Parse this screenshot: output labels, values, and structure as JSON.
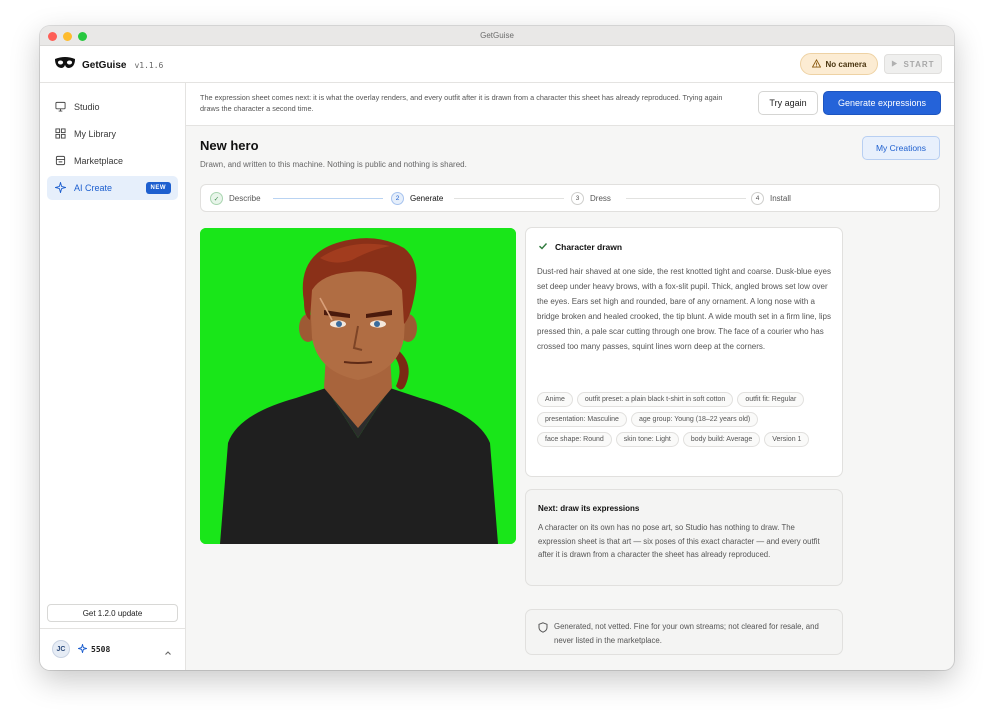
{
  "window": {
    "title": "GetGuise"
  },
  "app": {
    "name": "GetGuise",
    "version": "v1.1.6"
  },
  "topbar": {
    "camera_status": "No camera",
    "start_label": "START"
  },
  "sidebar": {
    "items": [
      {
        "label": "Studio",
        "icon": "monitor-icon"
      },
      {
        "label": "My Library",
        "icon": "grid-icon"
      },
      {
        "label": "Marketplace",
        "icon": "store-icon"
      },
      {
        "label": "AI Create",
        "icon": "sparkle-icon",
        "badge": "NEW",
        "active": true
      }
    ],
    "update_label": "Get 1.2.0 update",
    "user": {
      "initials": "JC",
      "credits": "5508"
    }
  },
  "notice": {
    "text": "The expression sheet comes next: it is what the overlay renders, and every outfit after it is drawn from a character this sheet has already reproduced. Trying again draws the character a second time.",
    "retry_label": "Try again",
    "generate_label": "Generate expressions"
  },
  "page": {
    "title": "New hero",
    "subtitle": "Drawn, and written to this machine. Nothing is public and nothing is shared.",
    "creations_label": "My Creations"
  },
  "steps": [
    {
      "num": "✓",
      "label": "Describe",
      "state": "done"
    },
    {
      "num": "2",
      "label": "Generate",
      "state": "current"
    },
    {
      "num": "3",
      "label": "Dress",
      "state": "pending"
    },
    {
      "num": "4",
      "label": "Install",
      "state": "pending"
    }
  ],
  "character": {
    "status": "Character drawn",
    "description": "Dust-red hair shaved at one side, the rest knotted tight and coarse. Dusk-blue eyes set deep under heavy brows, with a fox-slit pupil. Thick, angled brows set low over the eyes. Ears set high and rounded, bare of any ornament. A long nose with a bridge broken and healed crooked, the tip blunt. A wide mouth set in a firm line, lips pressed thin, a pale scar cutting through one brow. The face of a courier who has crossed too many passes, squint lines worn deep at the corners.",
    "tags": [
      "Anime",
      "outfit preset: a plain black t-shirt in soft cotton",
      "outfit fit: Regular",
      "presentation: Masculine",
      "age group: Young (18–22 years old)",
      "face shape: Round",
      "skin tone: Light",
      "body build: Average",
      "Version 1"
    ],
    "backdrop_color": "#19e619"
  },
  "next": {
    "title": "Next: draw its expressions",
    "body": "A character on its own has no pose art, so Studio has nothing to draw. The expression sheet is that art — six poses of this exact character — and every outfit after it is drawn from a character the sheet has already reproduced."
  },
  "vetting": {
    "text": "Generated, not vetted. Fine for your own streams; not cleared for resale, and never listed in the marketplace."
  },
  "colors": {
    "accent": "#2563d9",
    "badge": "#1d5fcf",
    "warning_bg": "#fcecd3"
  }
}
